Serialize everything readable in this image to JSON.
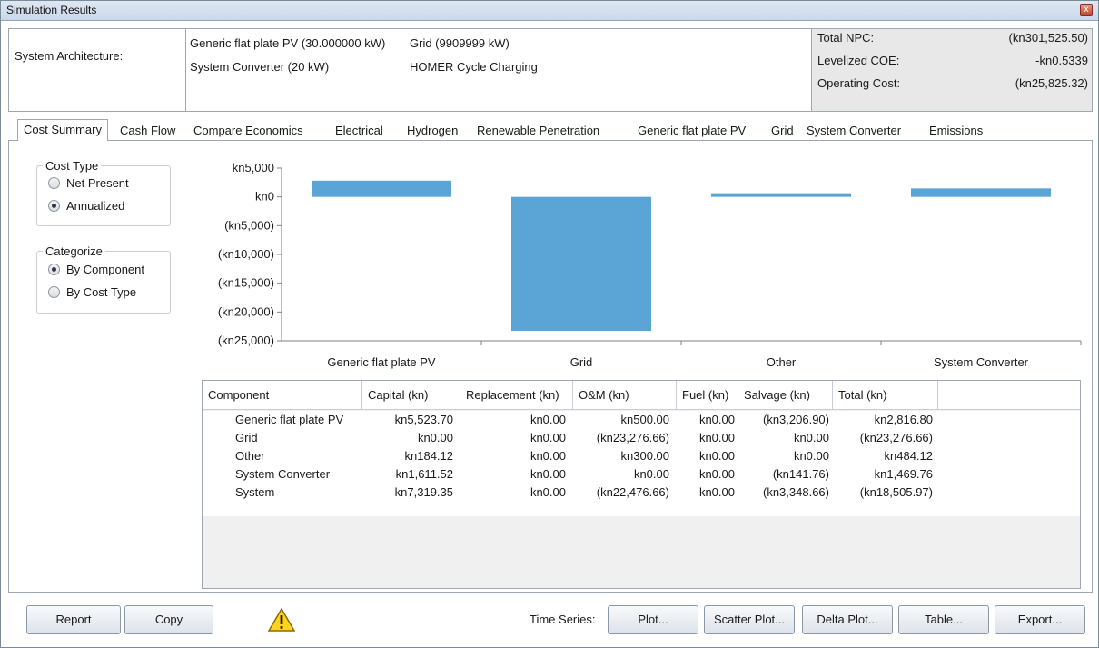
{
  "window": {
    "title": "Simulation Results",
    "close_glyph": "x"
  },
  "architecture": {
    "label": "System Architecture:",
    "pv": "Generic flat plate PV (30.000000 kW)",
    "grid": "Grid (9909999 kW)",
    "converter": "System Converter (20 kW)",
    "dispatch": "HOMER Cycle Charging"
  },
  "costs": {
    "npc_label": "Total NPC:",
    "npc_value": "(kn301,525.50)",
    "coe_label": "Levelized COE:",
    "coe_value": "-kn0.5339",
    "opex_label": "Operating Cost:",
    "opex_value": "(kn25,825.32)"
  },
  "tabs": [
    "Cost Summary",
    "Cash Flow",
    "Compare Economics",
    "Electrical",
    "Hydrogen",
    "Renewable Penetration",
    "Generic flat plate PV",
    "Grid",
    "System Converter",
    "Emissions"
  ],
  "active_tab": "Cost Summary",
  "cost_type": {
    "legend": "Cost Type",
    "options": [
      "Net Present",
      "Annualized"
    ],
    "selected": "Annualized"
  },
  "categorize": {
    "legend": "Categorize",
    "options": [
      "By Component",
      "By Cost Type"
    ],
    "selected": "By Component"
  },
  "chart_data": {
    "type": "bar",
    "categories": [
      "Generic flat plate PV",
      "Grid",
      "Other",
      "System Converter"
    ],
    "values": [
      2816.8,
      -23276.66,
      484.12,
      1469.76
    ],
    "ylim": [
      -25000,
      5000
    ],
    "yticks": [
      5000,
      0,
      -5000,
      -10000,
      -15000,
      -20000,
      -25000
    ],
    "ytick_labels": [
      "kn5,000",
      "kn0",
      "(kn5,000)",
      "(kn10,000)",
      "(kn15,000)",
      "(kn20,000)",
      "(kn25,000)"
    ],
    "bar_color": "#5aa5d6",
    "grid": false
  },
  "table": {
    "headers": [
      "Component",
      "Capital (kn)",
      "Replacement (kn)",
      "O&M (kn)",
      "Fuel (kn)",
      "Salvage (kn)",
      "Total (kn)"
    ],
    "rows": [
      [
        "Generic flat plate PV",
        "kn5,523.70",
        "kn0.00",
        "kn500.00",
        "kn0.00",
        "(kn3,206.90)",
        "kn2,816.80"
      ],
      [
        "Grid",
        "kn0.00",
        "kn0.00",
        "(kn23,276.66)",
        "kn0.00",
        "kn0.00",
        "(kn23,276.66)"
      ],
      [
        "Other",
        "kn184.12",
        "kn0.00",
        "kn300.00",
        "kn0.00",
        "kn0.00",
        "kn484.12"
      ],
      [
        "System Converter",
        "kn1,611.52",
        "kn0.00",
        "kn0.00",
        "kn0.00",
        "(kn141.76)",
        "kn1,469.76"
      ],
      [
        "System",
        "kn7,319.35",
        "kn0.00",
        "(kn22,476.66)",
        "kn0.00",
        "(kn3,348.66)",
        "(kn18,505.97)"
      ]
    ]
  },
  "footer": {
    "report": "Report",
    "copy": "Copy",
    "time_series_label": "Time Series:",
    "plot": "Plot...",
    "scatter": "Scatter Plot...",
    "delta": "Delta Plot...",
    "table": "Table...",
    "export": "Export..."
  },
  "icons": {
    "warning": "warning-icon",
    "close": "close-icon"
  }
}
